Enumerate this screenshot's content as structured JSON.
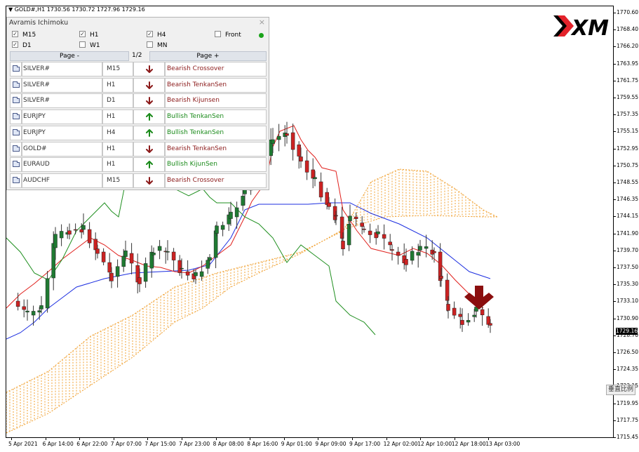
{
  "chart": {
    "header": "▼ GOLD#,H1  1730.56 1730.72 1727.96 1729.16",
    "current_price": "1729.16",
    "price_labels": [
      "1770.60",
      "1768.40",
      "1766.20",
      "1763.95",
      "1761.75",
      "1759.55",
      "1757.35",
      "1755.15",
      "1752.95",
      "1750.75",
      "1748.55",
      "1746.35",
      "1744.15",
      "1741.90",
      "1739.70",
      "1737.50",
      "1735.30",
      "1733.10",
      "1730.90",
      "1728.70",
      "1726.50",
      "1724.35",
      "1722.15",
      "1719.95",
      "1717.75",
      "1715.45"
    ],
    "time_labels": [
      "5 Apr 2021",
      "6 Apr 14:00",
      "6 Apr 22:00",
      "7 Apr 07:00",
      "7 Apr 15:00",
      "7 Apr 23:00",
      "8 Apr 08:00",
      "8 Apr 16:00",
      "9 Apr 01:00",
      "9 Apr 09:00",
      "9 Apr 17:00",
      "12 Apr 02:00",
      "12 Apr 10:00",
      "12 Apr 18:00",
      "13 Apr 03:00"
    ],
    "scale_button": "垂直比例",
    "colors": {
      "bull": "#1f7a32",
      "bear": "#cc2222",
      "tenkan": "#e0201c",
      "kijun": "#1c2ee0",
      "chikou": "#1f8f1f",
      "kumo": "#f0a030",
      "signal_arrow": "#8b0e0e"
    }
  },
  "logo_icon": "xm-logo",
  "panel": {
    "title": "Avramis Ichimoku",
    "close_icon": "×",
    "timeframes": [
      {
        "label": "M15",
        "checked": true
      },
      {
        "label": "H1",
        "checked": true
      },
      {
        "label": "H4",
        "checked": true
      },
      {
        "label": "Front",
        "checked": false
      },
      {
        "label": "D1",
        "checked": true
      },
      {
        "label": "W1",
        "checked": false
      },
      {
        "label": "MN",
        "checked": false
      }
    ],
    "page_prev": "Page -",
    "page_num": "1/2",
    "page_next": "Page +",
    "rows": [
      {
        "symbol": "SILVER#",
        "tf": "M15",
        "dir": "down",
        "signal": "Bearish Crossover"
      },
      {
        "symbol": "SILVER#",
        "tf": "H1",
        "dir": "down",
        "signal": "Bearish TenkanSen"
      },
      {
        "symbol": "SILVER#",
        "tf": "D1",
        "dir": "down",
        "signal": "Bearish Kijunsen"
      },
      {
        "symbol": "EURJPY",
        "tf": "H1",
        "dir": "up",
        "signal": "Bullish TenkanSen"
      },
      {
        "symbol": "EURJPY",
        "tf": "H4",
        "dir": "up",
        "signal": "Bullish TenkanSen"
      },
      {
        "symbol": "GOLD#",
        "tf": "H1",
        "dir": "down",
        "signal": "Bearish TenkanSen"
      },
      {
        "symbol": "EURAUD",
        "tf": "H1",
        "dir": "up",
        "signal": "Bullish KijunSen"
      },
      {
        "symbol": "AUDCHF",
        "tf": "M15",
        "dir": "down",
        "signal": "Bearish Crossover"
      }
    ]
  }
}
